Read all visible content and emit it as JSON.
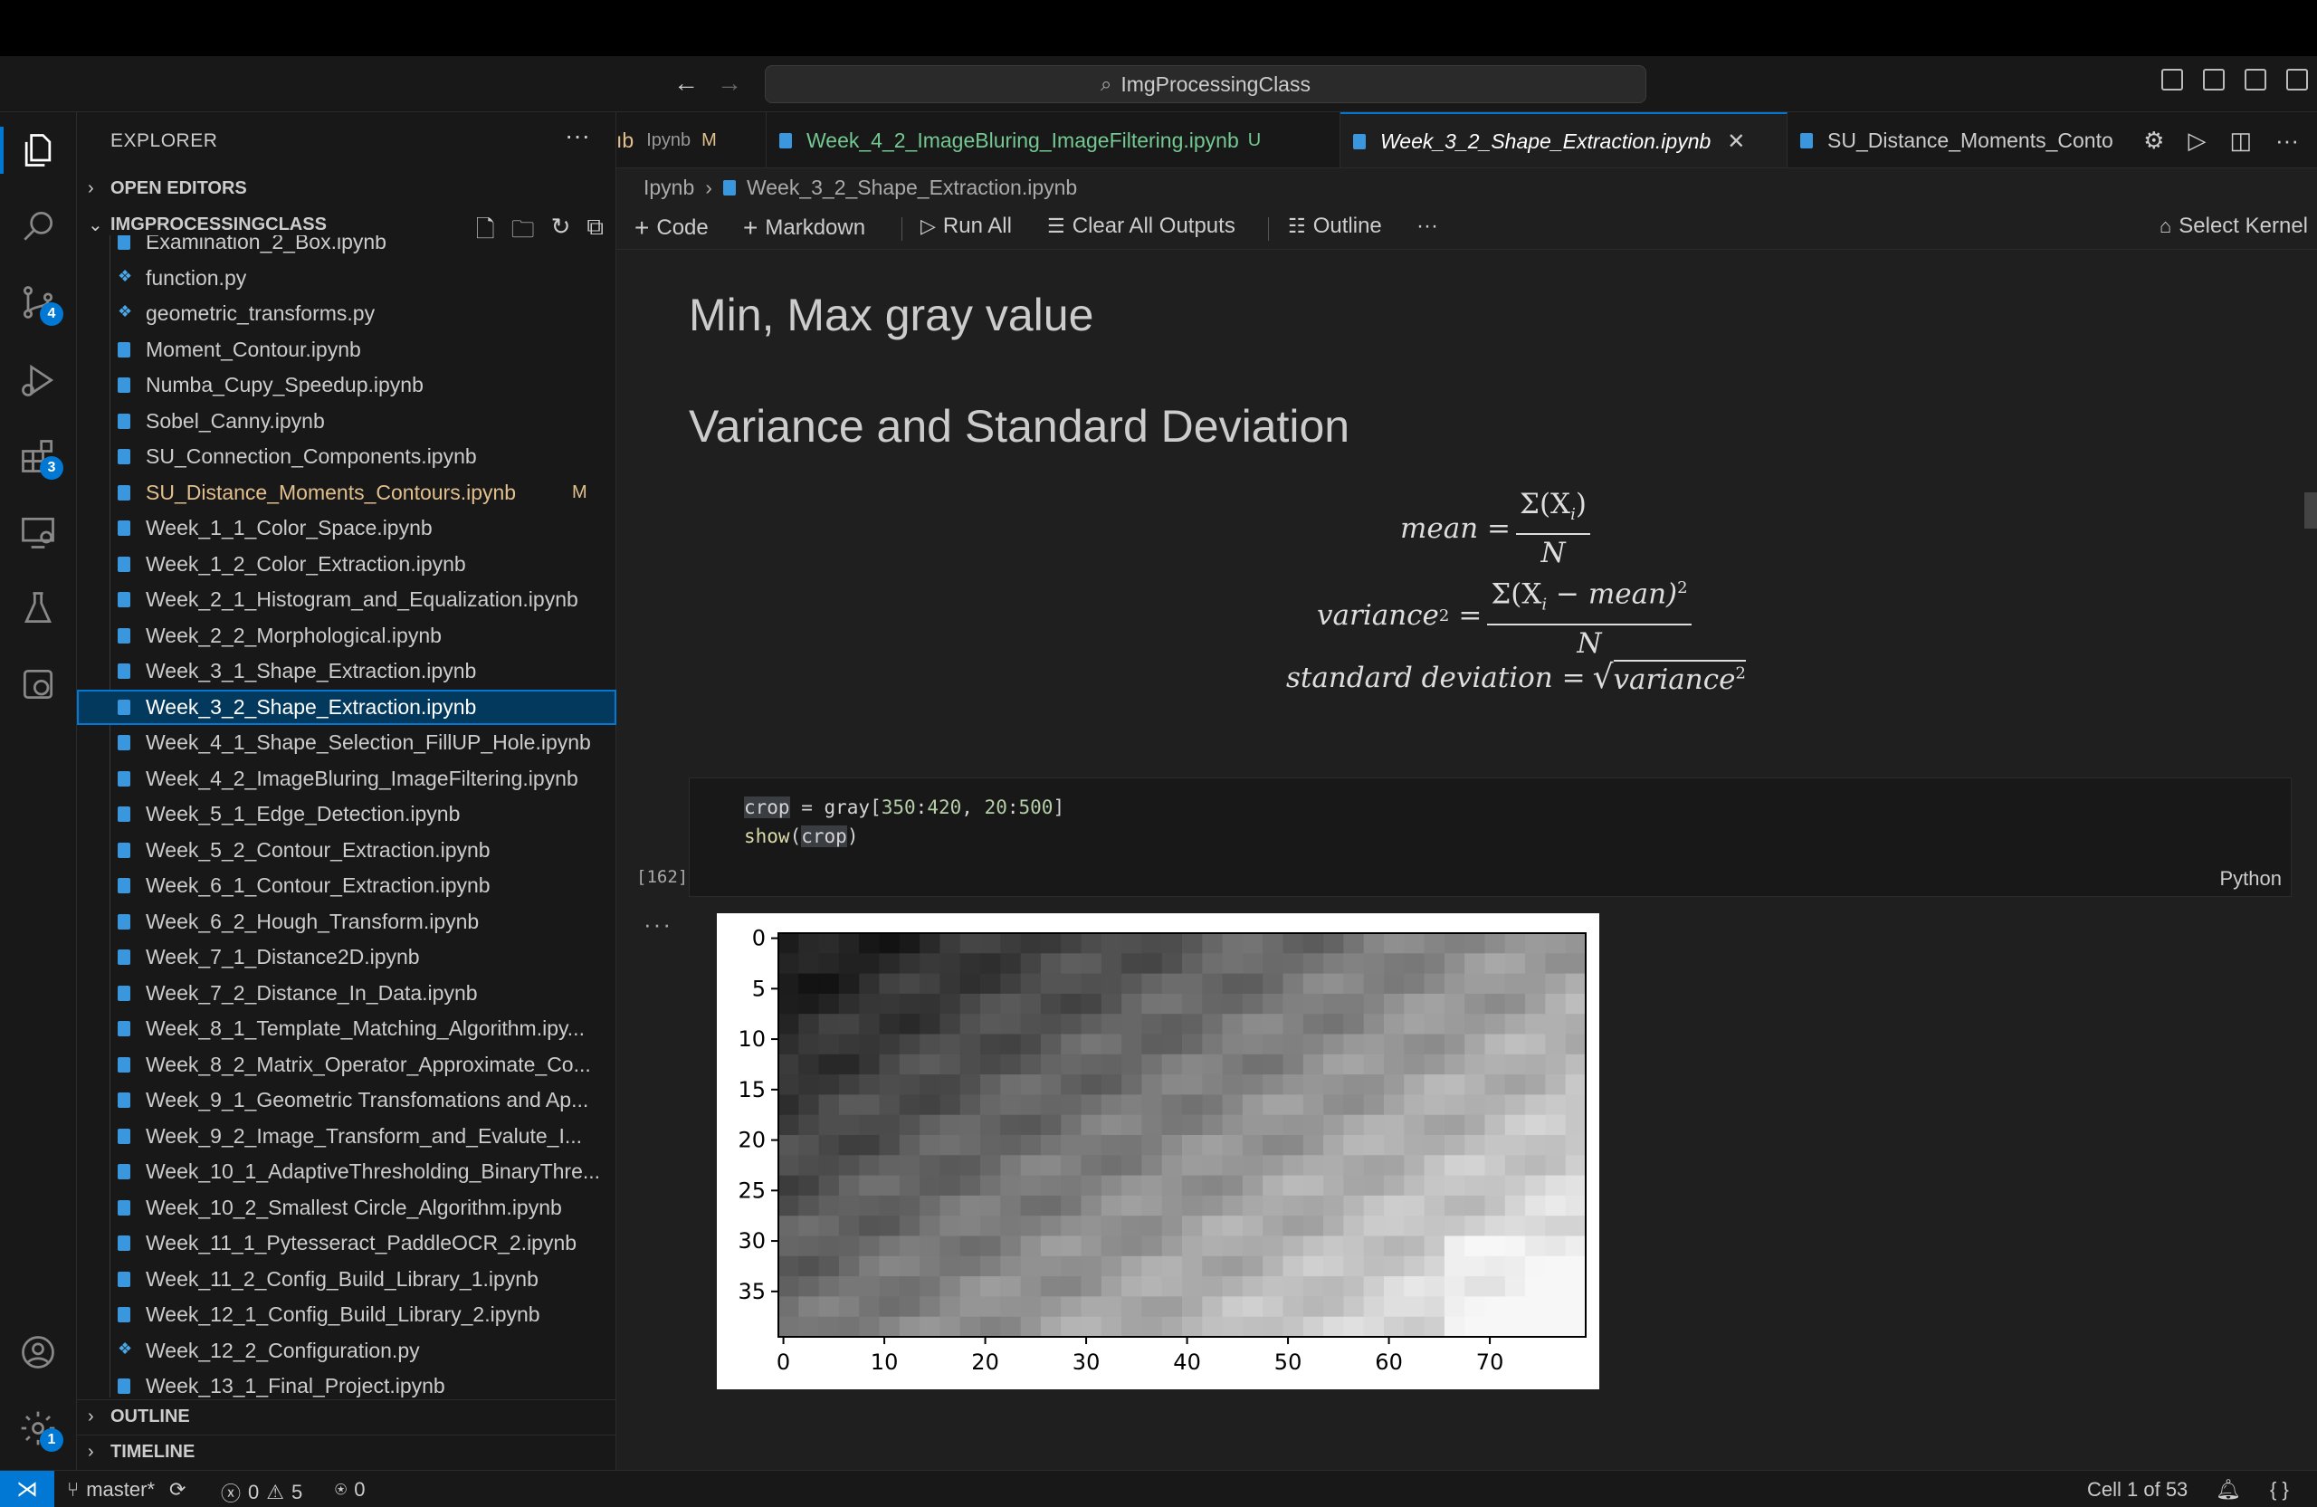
{
  "window": {
    "search_text": "ImgProcessingClass"
  },
  "activity_bar": {
    "items": [
      {
        "name": "explorer"
      },
      {
        "name": "search"
      },
      {
        "name": "source-control",
        "badge": "4"
      },
      {
        "name": "run-debug"
      },
      {
        "name": "extensions",
        "badge": "3"
      },
      {
        "name": "remote-explorer"
      },
      {
        "name": "testing"
      },
      {
        "name": "containers"
      }
    ],
    "accounts_badge": "",
    "settings_badge": "1"
  },
  "sidebar": {
    "title": "EXPLORER",
    "open_editors": "OPEN EDITORS",
    "folder": "IMGPROCESSINGCLASS",
    "outline": "OUTLINE",
    "timeline": "TIMELINE",
    "files": [
      {
        "name": "Examination_2_Box.ipynb",
        "type": "nb"
      },
      {
        "name": "function.py",
        "type": "py"
      },
      {
        "name": "geometric_transforms.py",
        "type": "py"
      },
      {
        "name": "Moment_Contour.ipynb",
        "type": "nb"
      },
      {
        "name": "Numba_Cupy_Speedup.ipynb",
        "type": "nb"
      },
      {
        "name": "Sobel_Canny.ipynb",
        "type": "nb"
      },
      {
        "name": "SU_Connection_Components.ipynb",
        "type": "nb"
      },
      {
        "name": "SU_Distance_Moments_Contours.ipynb",
        "type": "nb",
        "status": "M"
      },
      {
        "name": "Week_1_1_Color_Space.ipynb",
        "type": "nb"
      },
      {
        "name": "Week_1_2_Color_Extraction.ipynb",
        "type": "nb"
      },
      {
        "name": "Week_2_1_Histogram_and_Equalization.ipynb",
        "type": "nb"
      },
      {
        "name": "Week_2_2_Morphological.ipynb",
        "type": "nb"
      },
      {
        "name": "Week_3_1_Shape_Extraction.ipynb",
        "type": "nb"
      },
      {
        "name": "Week_3_2_Shape_Extraction.ipynb",
        "type": "nb",
        "selected": true
      },
      {
        "name": "Week_4_1_Shape_Selection_FillUP_Hole.ipynb",
        "type": "nb"
      },
      {
        "name": "Week_4_2_ImageBluring_ImageFiltering.ipynb",
        "type": "nb"
      },
      {
        "name": "Week_5_1_Edge_Detection.ipynb",
        "type": "nb"
      },
      {
        "name": "Week_5_2_Contour_Extraction.ipynb",
        "type": "nb"
      },
      {
        "name": "Week_6_1_Contour_Extraction.ipynb",
        "type": "nb"
      },
      {
        "name": "Week_6_2_Hough_Transform.ipynb",
        "type": "nb"
      },
      {
        "name": "Week_7_1_Distance2D.ipynb",
        "type": "nb"
      },
      {
        "name": "Week_7_2_Distance_In_Data.ipynb",
        "type": "nb"
      },
      {
        "name": "Week_8_1_Template_Matching_Algorithm.ipy...",
        "type": "nb"
      },
      {
        "name": "Week_8_2_Matrix_Operator_Approximate_Co...",
        "type": "nb"
      },
      {
        "name": "Week_9_1_Geometric Transfomations and Ap...",
        "type": "nb"
      },
      {
        "name": "Week_9_2_Image_Transform_and_Evalute_I...",
        "type": "nb"
      },
      {
        "name": "Week_10_1_AdaptiveThresholding_BinaryThre...",
        "type": "nb"
      },
      {
        "name": "Week_10_2_Smallest Circle_Algorithm.ipynb",
        "type": "nb"
      },
      {
        "name": "Week_11_1_Pytesseract_PaddleOCR_2.ipynb",
        "type": "nb"
      },
      {
        "name": "Week_11_2_Config_Build_Library_1.ipynb",
        "type": "nb"
      },
      {
        "name": "Week_12_1_Config_Build_Library_2.ipynb",
        "type": "nb"
      },
      {
        "name": "Week_12_2_Configuration.py",
        "type": "py"
      },
      {
        "name": "Week_13_1_Final_Project.ipynb",
        "type": "nb"
      }
    ]
  },
  "tabs": [
    {
      "label": "ıb",
      "suffix": "Ipynb",
      "status": "M",
      "color": "#e2c08d"
    },
    {
      "label": "Week_4_2_ImageBluring_ImageFiltering.ipynb",
      "status": "U",
      "color": "#73c991"
    },
    {
      "label": "Week_3_2_Shape_Extraction.ipynb",
      "active": true
    },
    {
      "label": "SU_Distance_Moments_Conto",
      "color": "#cccccc"
    }
  ],
  "breadcrumb": {
    "folder": "Ipynb",
    "file": "Week_3_2_Shape_Extraction.ipynb"
  },
  "toolbar": {
    "code": "Code",
    "markdown": "Markdown",
    "run_all": "Run All",
    "clear_outputs": "Clear All Outputs",
    "outline": "Outline",
    "more": "···",
    "select_kernel": "Select Kernel"
  },
  "notebook": {
    "heading1": "Min, Max gray value",
    "heading2": "Variance and Standard Deviation",
    "formulas": {
      "mean_lhs": "mean =",
      "mean_num": "Σ(X",
      "mean_sub": "i",
      "mean_num_end": ")",
      "mean_den": "N",
      "var_lhs": "variance",
      "var_sup": "2",
      "var_eq": "=",
      "var_num": "Σ(X",
      "var_sub": "i",
      "var_num_mid": " − mean)",
      "var_num_sup": "2",
      "var_den": "N",
      "std_lhs": "standard deviation =",
      "std_rad": "variance",
      "std_sup": "2"
    },
    "cell": {
      "line1_a": "crop",
      "line1_b": " = gray[",
      "line1_c": "350",
      "line1_d": ":",
      "line1_e": "420",
      "line1_f": ", ",
      "line1_g": "20",
      "line1_h": ":",
      "line1_i": "500",
      "line1_j": "]",
      "line2_a": "show",
      "line2_b": "(",
      "line2_c": "crop",
      "line2_d": ")",
      "exec_count": "[162]",
      "language": "Python"
    },
    "output_more": "···"
  },
  "chart_data": {
    "type": "heatmap",
    "x_ticks": [
      "0",
      "10",
      "20",
      "30",
      "40",
      "50",
      "60",
      "70"
    ],
    "y_ticks": [
      "0",
      "5",
      "10",
      "15",
      "20",
      "25",
      "30",
      "35"
    ],
    "xlim": [
      -0.5,
      79.5
    ],
    "ylim": [
      39.5,
      -0.5
    ],
    "colormap": "gray",
    "shape": [
      40,
      80
    ],
    "description_values": "grayscale gradient from dark upper-left to light lower-right"
  },
  "status": {
    "branch": "master*",
    "errors": "0",
    "warnings": "5",
    "ports": "0",
    "cell_pos": "Cell 1 of 53"
  }
}
